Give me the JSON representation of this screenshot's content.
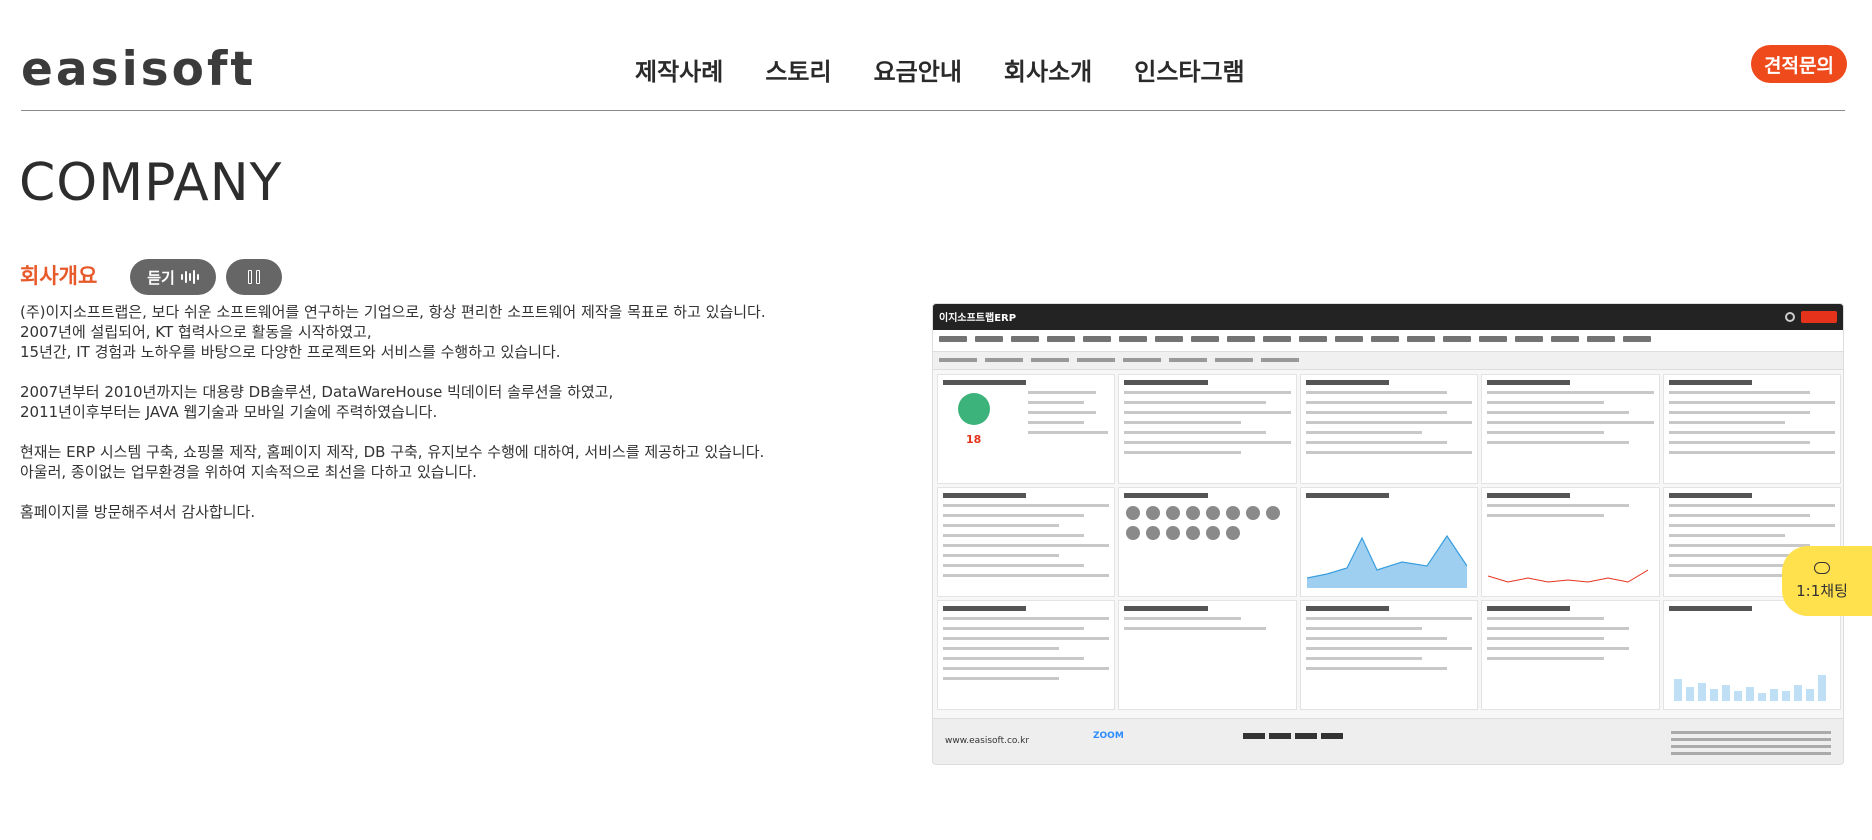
{
  "header": {
    "logo": "easisoft",
    "nav": [
      "제작사례",
      "스토리",
      "요금안내",
      "회사소개",
      "인스타그램"
    ],
    "quote_button": "견적문의"
  },
  "page": {
    "title": "COMPANY",
    "section_title": "회사개요",
    "listen_button": "듣기",
    "intro": [
      "(주)이지소프트랩은, 보다 쉬운 소프트웨어를 연구하는 기업으로, 항상 편리한 소프트웨어 제작을 목표로 하고 있습니다.",
      "2007년에 설립되어, KT 협력사으로 활동을 시작하였고,",
      "15년간, IT 경험과 노하우를 바탕으로 다양한 프로젝트와 서비스를 수행하고 있습니다.",
      "",
      "2007년부터 2010년까지는 대용량 DB솔루션, DataWareHouse 빅데이터 솔루션을 하였고,",
      "2011년이후부터는 JAVA 웹기술과 모바일 기술에 주력하였습니다.",
      "",
      "현재는 ERP 시스템 구축, 쇼핑몰 제작, 홈페이지 제작, DB 구축, 유지보수 수행에 대하여, 서비스를 제공하고 있습니다.",
      "아울러, 종이없는 업무환경을 위하여 지속적으로 최선을 다하고 있습니다.",
      "",
      "홈페이지를 방문해주셔서 감사합니다."
    ]
  },
  "erp_preview": {
    "brand": "이지소프트랩ERP",
    "number": "18",
    "zoom": "ZOOM",
    "site": "www.easisoft.co.kr"
  },
  "chat": {
    "label": "1:1채팅"
  },
  "colors": {
    "accent": "#ef4a1c",
    "section_title": "#e8592a",
    "chat_bg": "#ffe04d",
    "control_bg": "#666666"
  }
}
